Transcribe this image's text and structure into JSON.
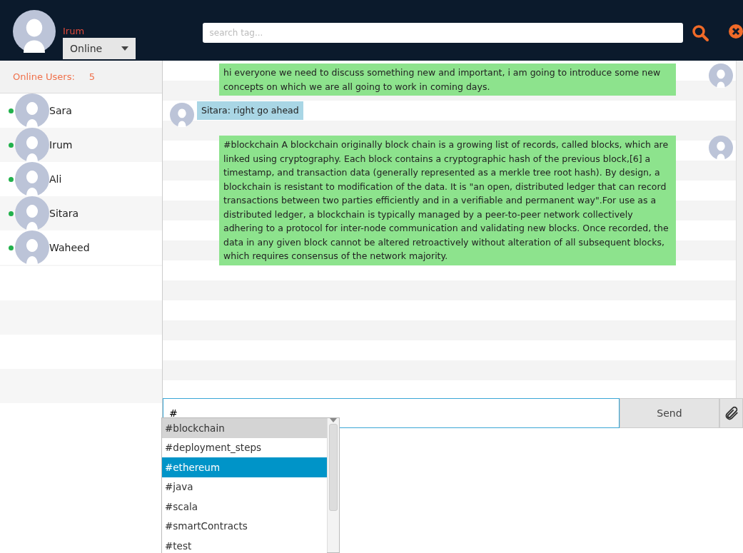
{
  "header": {
    "user_name": "Irum",
    "status": "Online",
    "search": {
      "placeholder": "search tag..."
    }
  },
  "sidebar": {
    "label": "Online Users:",
    "count": "5",
    "users": [
      {
        "name": "Sara",
        "online": true
      },
      {
        "name": "Irum",
        "online": true
      },
      {
        "name": "Ali",
        "online": true
      },
      {
        "name": "Sitara",
        "online": true
      },
      {
        "name": "Waheed",
        "online": true
      }
    ]
  },
  "messages": [
    {
      "kind": "sent",
      "text": "hi everyone we need to discuss something new and important, i am going to introduce some new concepts on which we are all going to work in coming days."
    },
    {
      "kind": "received",
      "text": "Sitara: right go ahead"
    },
    {
      "kind": "sent",
      "text": "#blockchain A blockchain originally block chain is a growing list of records, called blocks, which are linked using cryptography. Each block contains a cryptographic hash of the previous block,[6] a timestamp, and transaction data (generally represented as a merkle tree root hash). By design, a blockchain is resistant to modification of the data. It is \"an open, distributed ledger that can record transactions between two parties efficiently and in a verifiable and permanent way\".For use as a distributed ledger, a blockchain is typically managed by a peer-to-peer network collectively adhering to a protocol for inter-node communication and validating new blocks. Once recorded, the data in any given block cannot be altered retroactively without alteration of all subsequent blocks, which requires consensus of the network majority."
    }
  ],
  "composer": {
    "value": "#",
    "send": "Send"
  },
  "suggestions": [
    {
      "tag": "#blockchain",
      "selected": false,
      "hovered": true
    },
    {
      "tag": "#deployment_steps",
      "selected": false,
      "hovered": false
    },
    {
      "tag": "#ethereum",
      "selected": true,
      "hovered": false
    },
    {
      "tag": "#java",
      "selected": false,
      "hovered": false
    },
    {
      "tag": "#scala",
      "selected": false,
      "hovered": false
    },
    {
      "tag": "#smartContracts",
      "selected": false,
      "hovered": false
    },
    {
      "tag": "#test",
      "selected": false,
      "hovered": false
    }
  ]
}
